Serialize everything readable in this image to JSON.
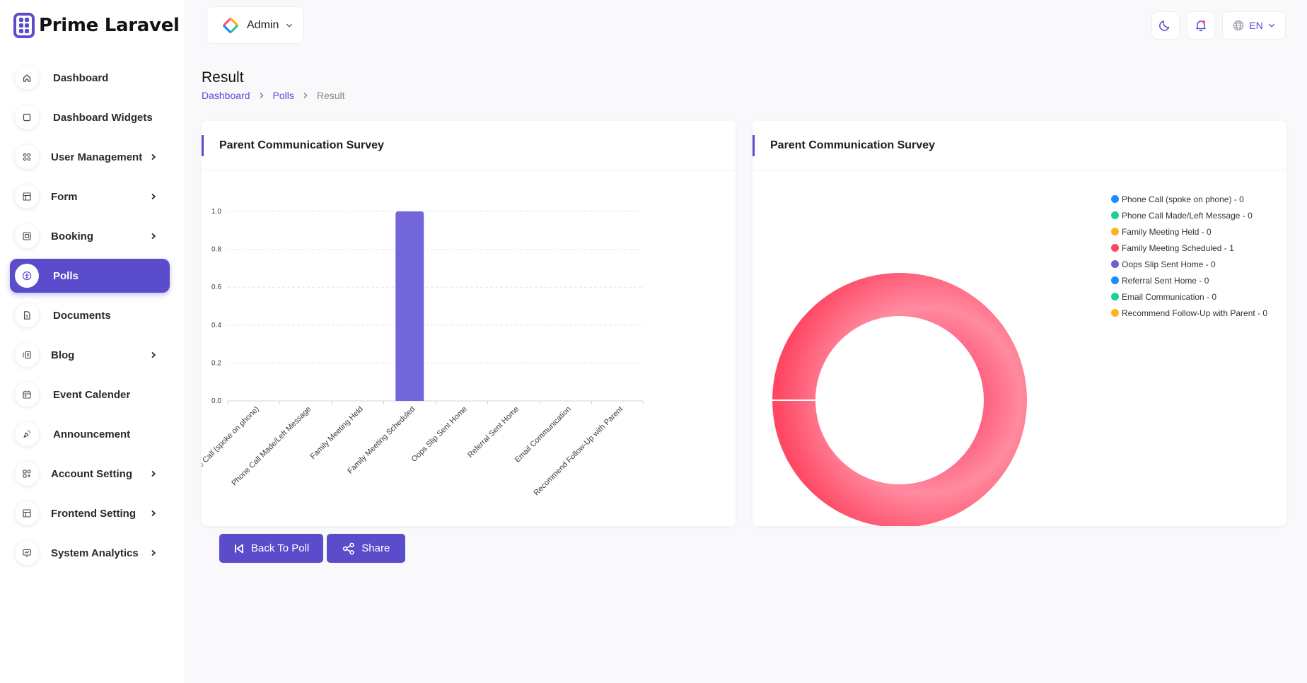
{
  "app": {
    "brand": "Prime Laravel"
  },
  "topbar": {
    "role_label": "Admin",
    "language": "EN"
  },
  "sidebar": {
    "items": [
      {
        "label": "Dashboard",
        "icon": "home-icon",
        "has_children": false,
        "active": false
      },
      {
        "label": "Dashboard Widgets",
        "icon": "square-icon",
        "has_children": false,
        "active": false
      },
      {
        "label": "User Management",
        "icon": "grid-icon",
        "has_children": true,
        "active": false
      },
      {
        "label": "Form",
        "icon": "table-icon",
        "has_children": true,
        "active": false
      },
      {
        "label": "Booking",
        "icon": "booking-icon",
        "has_children": true,
        "active": false
      },
      {
        "label": "Polls",
        "icon": "poll-icon",
        "has_children": false,
        "active": true
      },
      {
        "label": "Documents",
        "icon": "document-icon",
        "has_children": false,
        "active": false
      },
      {
        "label": "Blog",
        "icon": "blog-icon",
        "has_children": true,
        "active": false
      },
      {
        "label": "Event Calender",
        "icon": "calendar-icon",
        "has_children": false,
        "active": false
      },
      {
        "label": "Announcement",
        "icon": "announcement-icon",
        "has_children": false,
        "active": false
      },
      {
        "label": "Account Setting",
        "icon": "account-settings-icon",
        "has_children": true,
        "active": false
      },
      {
        "label": "Frontend Setting",
        "icon": "frontend-icon",
        "has_children": true,
        "active": false
      },
      {
        "label": "System Analytics",
        "icon": "analytics-icon",
        "has_children": true,
        "active": false
      }
    ]
  },
  "page": {
    "title": "Result",
    "breadcrumb": [
      "Dashboard",
      "Polls",
      "Result"
    ]
  },
  "cards": {
    "bar_title": "Parent Communication Survey",
    "donut_title": "Parent Communication Survey"
  },
  "actions": {
    "back_label": "Back To Poll",
    "share_label": "Share"
  },
  "colors": {
    "accent": "#5b4ccc",
    "bar": "#7366db",
    "donut": "#ff4d6d"
  },
  "chart_data": [
    {
      "type": "bar",
      "title": "Parent Communication Survey",
      "categories": [
        "Phone Call (spoke on phone)",
        "Phone Call Made/Left Message",
        "Family Meeting Held",
        "Family Meeting Scheduled",
        "Oops Slip Sent Home",
        "Referral Sent Home",
        "Email Communication",
        "Recommend Follow-Up with Parent"
      ],
      "values": [
        0,
        0,
        0,
        1,
        0,
        0,
        0,
        0
      ],
      "yticks": [
        "0.0",
        "0.2",
        "0.4",
        "0.6",
        "0.8",
        "1.0"
      ],
      "ylim": [
        0,
        1
      ],
      "grid": true
    },
    {
      "type": "pie",
      "title": "Parent Communication Survey",
      "legend_position": "right",
      "slices": [
        {
          "label": "Phone Call (spoke on phone) - 0",
          "value": 0,
          "color": "#1a8cff"
        },
        {
          "label": "Phone Call Made/Left Message - 0",
          "value": 0,
          "color": "#1ecf9a"
        },
        {
          "label": "Family Meeting Held - 0",
          "value": 0,
          "color": "#ffb21e"
        },
        {
          "label": "Family Meeting Scheduled - 1",
          "value": 1,
          "color": "#ff4560"
        },
        {
          "label": "Oops Slip Sent Home - 0",
          "value": 0,
          "color": "#775dd0"
        },
        {
          "label": "Referral Sent Home - 0",
          "value": 0,
          "color": "#1a8cff"
        },
        {
          "label": "Email Communication - 0",
          "value": 0,
          "color": "#1ecf9a"
        },
        {
          "label": "Recommend Follow-Up with Parent - 0",
          "value": 0,
          "color": "#ffb21e"
        }
      ]
    }
  ]
}
